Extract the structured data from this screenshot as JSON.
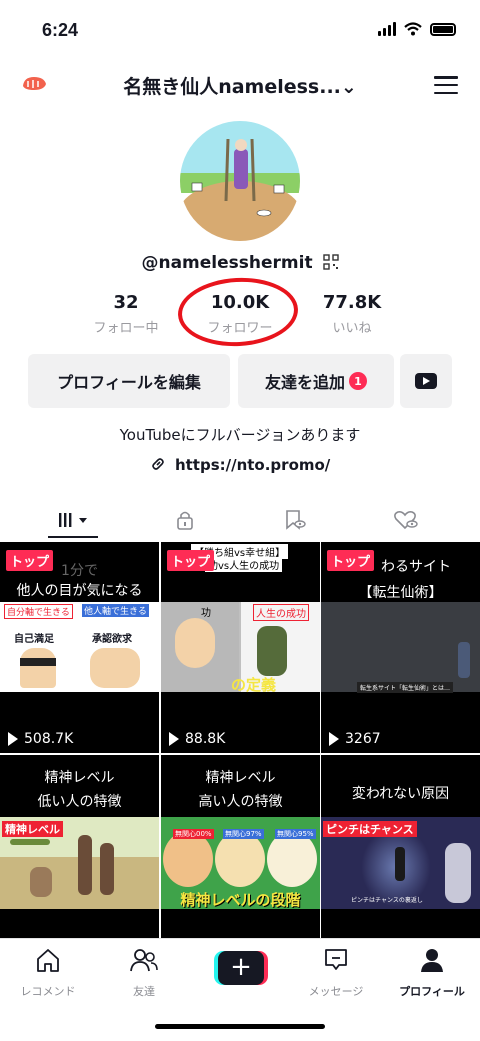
{
  "status": {
    "time": "6:24"
  },
  "header": {
    "title": "名無き仙人nameless...⌄"
  },
  "profile": {
    "handle": "@namelesshermit"
  },
  "stats": [
    {
      "value": "32",
      "label": "フォロー中"
    },
    {
      "value": "10.0K",
      "label": "フォロワー"
    },
    {
      "value": "77.8K",
      "label": "いいね"
    }
  ],
  "buttons": {
    "edit": "プロフィールを編集",
    "add_friends": "友達を追加",
    "badge": "1"
  },
  "bio": {
    "text": "YouTubeにフルバージョンあります",
    "link": "https://nto.promo/"
  },
  "videos": [
    {
      "pin": "トップ",
      "cap1": "1分で",
      "cap2": "他人の目が気になる",
      "t1": "自分軸で生きる",
      "t2": "他人軸で生きる",
      "t3": "自己満足",
      "t4": "承認欲求",
      "views": "508.7K"
    },
    {
      "pin": "トップ",
      "cap1": "【勝ち組vs幸せ組】",
      "cap2": "功vs人生の成功",
      "t1": "功",
      "t2": "人生の成功",
      "t3": "の定義",
      "views": "88.8K"
    },
    {
      "pin": "トップ",
      "cap1": "わるサイト",
      "cap2": "【転生仙術】",
      "t1": "転生系サイト「転生仙術」とは…",
      "views": "3267"
    },
    {
      "cap1": "精神レベル",
      "cap2": "低い人の特徴",
      "tag": "精神レベル"
    },
    {
      "cap1": "精神レベル",
      "cap2": "高い人の特徴",
      "tag": "精神レベルの段階",
      "b1": "無関心00%",
      "b2": "無関心97%",
      "b3": "無関心95%"
    },
    {
      "cap1": "変われない原因",
      "tag": "ピンチはチャンス",
      "sub": "ピンチはチャンスの裏返し"
    }
  ],
  "nav": [
    {
      "label": "レコメンド",
      "icon": "home-icon"
    },
    {
      "label": "友達",
      "icon": "friends-icon"
    },
    {
      "label": "",
      "icon": "plus-icon"
    },
    {
      "label": "メッセージ",
      "icon": "inbox-icon"
    },
    {
      "label": "プロフィール",
      "icon": "profile-icon"
    }
  ],
  "colors": {
    "accent": "#fe2c55",
    "annotation_ring": "#e8141c",
    "cyan": "#25f4ee"
  }
}
